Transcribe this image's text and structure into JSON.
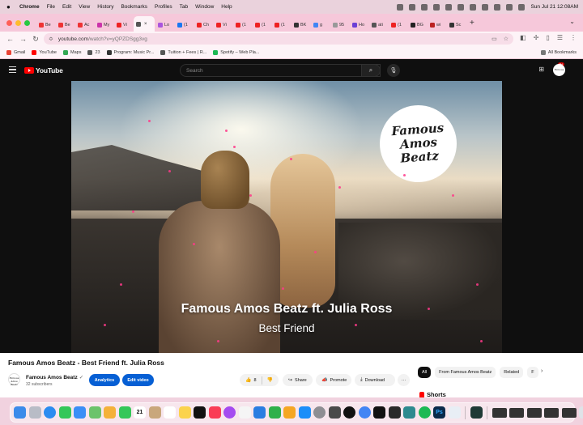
{
  "menubar": {
    "app": "Chrome",
    "items": [
      "File",
      "Edit",
      "View",
      "History",
      "Bookmarks",
      "Profiles",
      "Tab",
      "Window",
      "Help"
    ],
    "clock": "Sun Jul 21  12:08AM"
  },
  "tabs": [
    {
      "label": "Be",
      "color": "#e33"
    },
    {
      "label": "Be",
      "color": "#e33"
    },
    {
      "label": "Ac",
      "color": "#e33"
    },
    {
      "label": "My",
      "color": "#c3a"
    },
    {
      "label": "Vi",
      "color": "#e22"
    },
    {
      "label": "",
      "color": "#555",
      "active": true
    },
    {
      "label": "Lo",
      "color": "#a5d"
    },
    {
      "label": "(1",
      "color": "#1877f2"
    },
    {
      "label": "Ch",
      "color": "#e22"
    },
    {
      "label": "Vi",
      "color": "#e22"
    },
    {
      "label": "(1",
      "color": "#e22"
    },
    {
      "label": "(1",
      "color": "#e22"
    },
    {
      "label": "(1",
      "color": "#e22"
    },
    {
      "label": "BK",
      "color": "#333"
    },
    {
      "label": "g",
      "color": "#4285f4"
    },
    {
      "label": "95",
      "color": "#999"
    },
    {
      "label": "Ho",
      "color": "#6b3fd6"
    },
    {
      "label": "ati",
      "color": "#555"
    },
    {
      "label": "(1",
      "color": "#e22"
    },
    {
      "label": "BG",
      "color": "#222"
    },
    {
      "label": "wi",
      "color": "#b22"
    },
    {
      "label": "Sc",
      "color": "#333"
    }
  ],
  "omnibox": {
    "host": "youtube.com",
    "path": "/watch?v=yQPZDSgg3vg"
  },
  "bookmarks": [
    {
      "label": "Gmail",
      "color": "#ea4335"
    },
    {
      "label": "YouTube",
      "color": "#ff0000"
    },
    {
      "label": "Maps",
      "color": "#34a853"
    },
    {
      "label": "23",
      "color": "#555"
    },
    {
      "label": "Program: Music Pr...",
      "color": "#333"
    },
    {
      "label": "Tuition + Fees | R...",
      "color": "#555"
    },
    {
      "label": "Spotify – Web Pla...",
      "color": "#1db954"
    }
  ],
  "bookmarks_right": "All Bookmarks",
  "youtube": {
    "logo": "YouTube",
    "search_placeholder": "Search",
    "notifications": "9+",
    "avatar_text": "Famous Amos Beatz",
    "video": {
      "logo_text": "Famous Amos Beatz",
      "title": "Famous Amos Beatz ft. Julia Ross",
      "subtitle": "Best Friend"
    },
    "title": "Famous Amos Beatz - Best Friend ft. Julia Ross",
    "channel": {
      "name": "Famous Amos Beatz",
      "verified": "✓",
      "subscribers": "32 subscribers",
      "avatar_text": "Famous Amos Beatz"
    },
    "buttons": {
      "analytics": "Analytics",
      "edit": "Edit video",
      "likes": "8",
      "share": "Share",
      "promote": "Promote",
      "download": "Download",
      "more": "···"
    },
    "chips": [
      "All",
      "From Famous Amos Beatz",
      "Related",
      "F"
    ],
    "shorts": "Shorts"
  },
  "dock": {
    "icons": [
      {
        "name": "finder-icon",
        "color": "#3b8bea"
      },
      {
        "name": "launchpad-icon",
        "color": "#b8bcc6"
      },
      {
        "name": "safari-icon",
        "color": "#2b8cf0"
      },
      {
        "name": "messages-icon",
        "color": "#34c759"
      },
      {
        "name": "mail-icon",
        "color": "#3a8ef6"
      },
      {
        "name": "maps-icon",
        "color": "#6cc36b"
      },
      {
        "name": "photos-icon",
        "color": "#f4b13a"
      },
      {
        "name": "facetime-icon",
        "color": "#34c759"
      },
      {
        "name": "calendar-icon",
        "color": "#ffffff"
      },
      {
        "name": "contacts-icon",
        "color": "#c9a77c"
      },
      {
        "name": "reminders-icon",
        "color": "#ffffff"
      },
      {
        "name": "notes-icon",
        "color": "#fbd34d"
      },
      {
        "name": "tv-icon",
        "color": "#111111"
      },
      {
        "name": "music-icon",
        "color": "#fa3c55"
      },
      {
        "name": "podcasts-icon",
        "color": "#a54bf0"
      },
      {
        "name": "news-icon",
        "color": "#f5f5f5"
      },
      {
        "name": "keynote-icon",
        "color": "#2a7de1"
      },
      {
        "name": "numbers-icon",
        "color": "#2fb04a"
      },
      {
        "name": "pages-icon",
        "color": "#f5a623"
      },
      {
        "name": "appstore-icon",
        "color": "#1c8ef9"
      },
      {
        "name": "settings-icon",
        "color": "#8e8e93"
      },
      {
        "name": "screenshot-icon",
        "color": "#4a4a4a"
      },
      {
        "name": "clock-icon",
        "color": "#111111"
      },
      {
        "name": "chrome-icon",
        "color": "#4285f4"
      },
      {
        "name": "capcut-icon",
        "color": "#111111"
      },
      {
        "name": "studio-icon",
        "color": "#2a2a2a"
      },
      {
        "name": "pad-icon",
        "color": "#2d8a8f"
      },
      {
        "name": "spotify-icon",
        "color": "#1db954"
      },
      {
        "name": "photoshop-icon",
        "color": "#0b2a4a"
      },
      {
        "name": "preview-icon",
        "color": "#e8eef5"
      },
      {
        "name": "audio-icon",
        "color": "#1f3a36"
      }
    ],
    "calendar_day": "21",
    "ps_label": "Ps"
  }
}
